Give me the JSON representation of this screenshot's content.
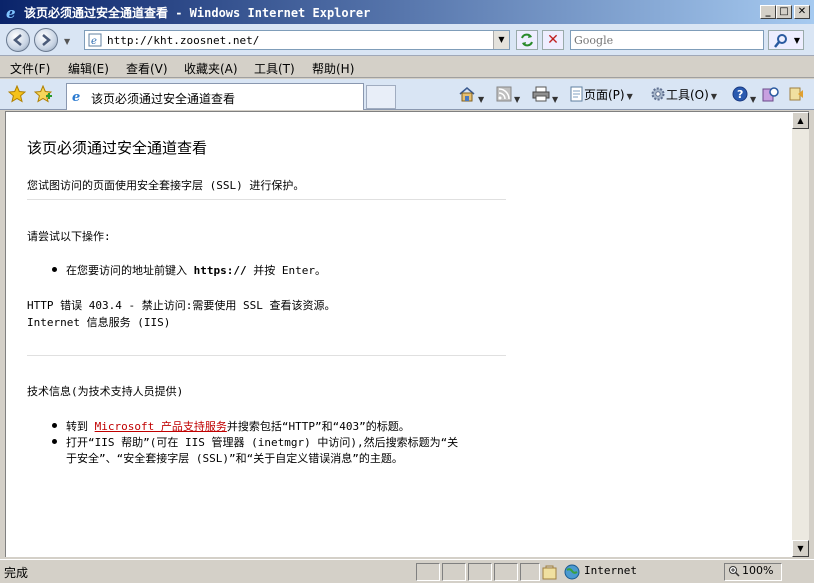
{
  "window": {
    "title": "该页必须通过安全通道查看 - Windows Internet Explorer",
    "minimize": "_",
    "maximize": "□",
    "close": "✕"
  },
  "address": {
    "url": "http://kht.zoosnet.net/",
    "search_placeholder": "Google"
  },
  "menu": {
    "items": [
      "文件(F)",
      "编辑(E)",
      "查看(V)",
      "收藏夹(A)",
      "工具(T)",
      "帮助(H)"
    ]
  },
  "tabs": {
    "active_title": "该页必须通过安全通道查看"
  },
  "commands": {
    "page": "页面(P)",
    "tools": "工具(O)"
  },
  "page": {
    "heading": "该页必须通过安全通道查看",
    "intro": "您试图访问的页面使用安全套接字层 (SSL) 进行保护。",
    "try_heading": "请尝试以下操作:",
    "try_bullet_pre": "在您要访问的地址前键入 ",
    "try_bullet_bold": "https://",
    "try_bullet_post": " 并按 Enter。",
    "error_line": "HTTP 错误 403.4 - 禁止访问:需要使用 SSL 查看该资源。",
    "service_line": "Internet 信息服务 (IIS)",
    "tech_heading": "技术信息(为技术支持人员提供)",
    "tech_b1_pre": "转到 ",
    "tech_b1_link": "Microsoft 产品支持服务",
    "tech_b1_post": "并搜索包括“HTTP”和“403”的标题。",
    "tech_b2_line1": "打开“IIS 帮助”(可在 IIS 管理器 (inetmgr) 中访问),然后搜索标题为“关",
    "tech_b2_line2": "于安全”、“安全套接字层 (SSL)”和“关于自定义错误消息”的主题。"
  },
  "status": {
    "text": "完成",
    "zone": "Internet",
    "zoom": "100%"
  }
}
